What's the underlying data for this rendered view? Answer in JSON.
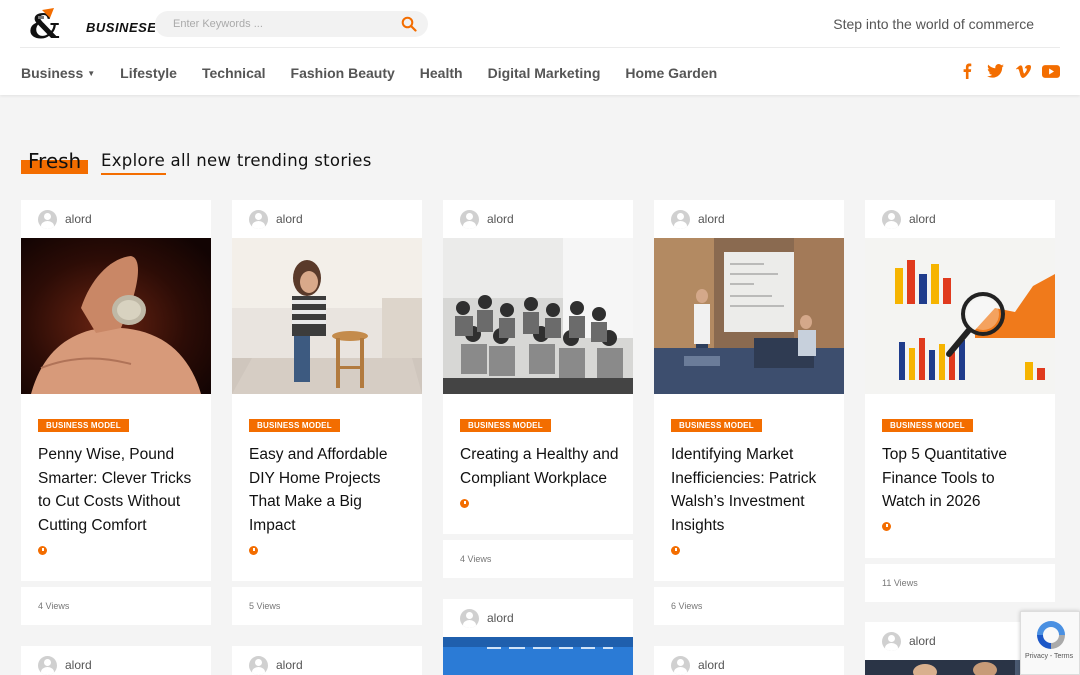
{
  "brand": {
    "logo_text": "BUSINESE",
    "tagline": "Step into the world of commerce"
  },
  "search": {
    "placeholder": "Enter Keywords ..."
  },
  "nav": {
    "items": [
      "Business",
      "Lifestyle",
      "Technical",
      "Fashion Beauty",
      "Health",
      "Digital Marketing",
      "Home Garden"
    ]
  },
  "social": [
    "facebook-icon",
    "twitter-icon",
    "vimeo-icon",
    "youtube-icon"
  ],
  "colors": {
    "accent": "#f36d00",
    "background": "#f4f4f4"
  },
  "section": {
    "label": "Fresh",
    "subtitle": "Explore all new trending stories"
  },
  "cards": [
    {
      "author": "alord",
      "category": "BUSINESS MODEL",
      "title": "Penny Wise, Pound Smarter: Clever Tricks to Cut Costs Without Cutting Comfort",
      "views": "4 Views",
      "image": "coin-in-hand"
    },
    {
      "author": "alord",
      "category": "BUSINESS MODEL",
      "title": "Easy and Affordable DIY Home Projects That Make a Big Impact",
      "views": "5 Views",
      "image": "woman-painting-stool"
    },
    {
      "author": "alord",
      "category": "BUSINESS MODEL",
      "title": "Creating a Healthy and Compliant Workplace",
      "views": "4 Views",
      "image": "group-meeting"
    },
    {
      "author": "alord",
      "category": "BUSINESS MODEL",
      "title": "Identifying Market Inefficiencies: Patrick Walsh’s Investment Insights",
      "views": "6 Views",
      "image": "whiteboard-presentation"
    },
    {
      "author": "alord",
      "category": "BUSINESS MODEL",
      "title": "Top 5 Quantitative Finance Tools to Watch in 2026",
      "views": "11 Views",
      "image": "charts-magnifier"
    }
  ],
  "next_row_authors": [
    "alord",
    "alord",
    "alord",
    "alord",
    "alord"
  ],
  "recaptcha": {
    "text": "Privacy - Terms"
  }
}
